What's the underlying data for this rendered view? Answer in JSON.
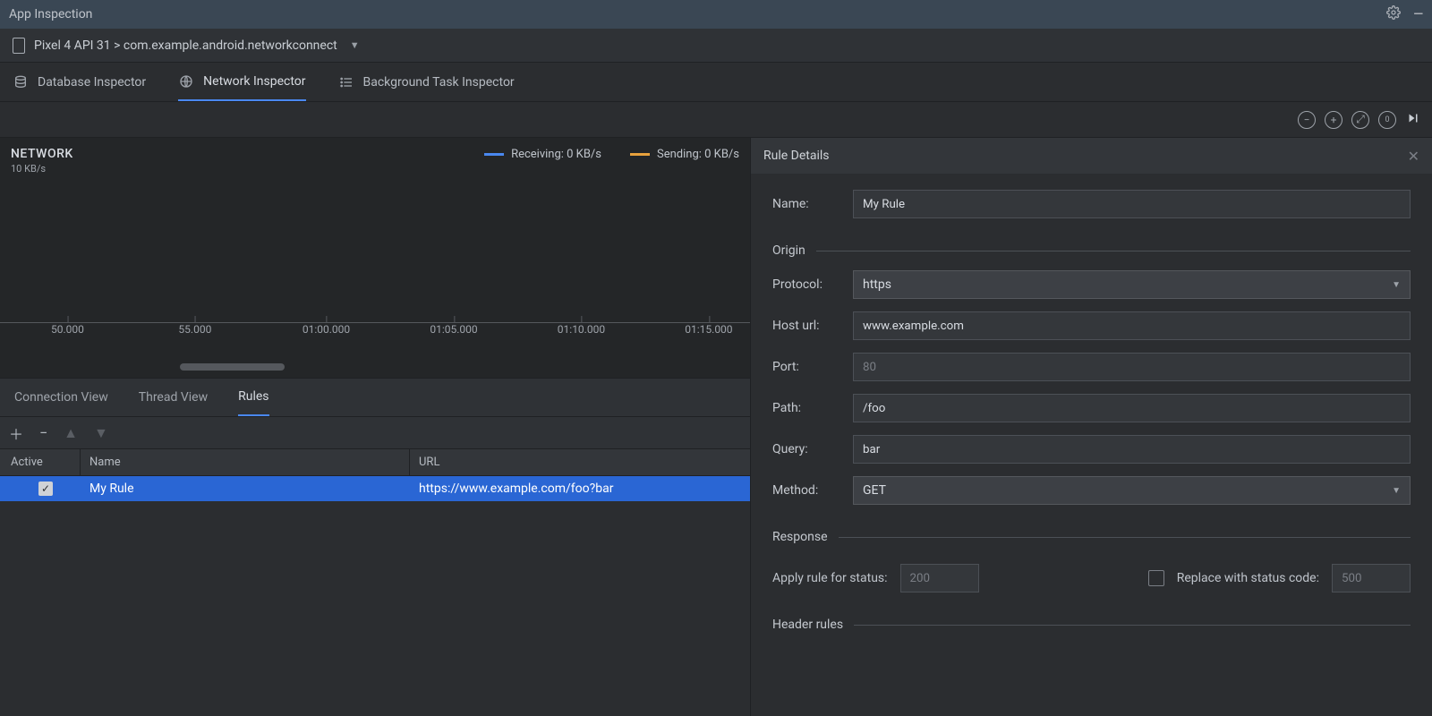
{
  "titlebar": {
    "title": "App Inspection"
  },
  "breadcrumb": {
    "text": "Pixel 4 API 31 > com.example.android.networkconnect"
  },
  "tabs": {
    "database": "Database Inspector",
    "network": "Network Inspector",
    "background": "Background Task Inspector"
  },
  "network": {
    "title": "NETWORK",
    "scale": "10 KB/s",
    "legend": {
      "receiving": "Receiving: 0 KB/s",
      "sending": "Sending: 0 KB/s"
    },
    "ticks": {
      "t0": "50.000",
      "t1": "55.000",
      "t2": "01:00.000",
      "t3": "01:05.000",
      "t4": "01:10.000",
      "t5": "01:15.000"
    }
  },
  "subtabs": {
    "connection": "Connection View",
    "thread": "Thread View",
    "rules": "Rules"
  },
  "rules_table": {
    "headers": {
      "active": "Active",
      "name": "Name",
      "url": "URL"
    },
    "row0": {
      "active": true,
      "name": "My Rule",
      "url": "https://www.example.com/foo?bar"
    }
  },
  "details": {
    "title": "Rule Details",
    "name_label": "Name:",
    "name_value": "My Rule",
    "origin_section": "Origin",
    "protocol_label": "Protocol:",
    "protocol_value": "https",
    "host_label": "Host url:",
    "host_value": "www.example.com",
    "port_label": "Port:",
    "port_placeholder": "80",
    "path_label": "Path:",
    "path_value": "/foo",
    "query_label": "Query:",
    "query_value": "bar",
    "method_label": "Method:",
    "method_value": "GET",
    "response_section": "Response",
    "apply_status_label": "Apply rule for status:",
    "apply_status_placeholder": "200",
    "replace_label": "Replace with status code:",
    "replace_placeholder": "500",
    "header_rules_section": "Header rules"
  }
}
